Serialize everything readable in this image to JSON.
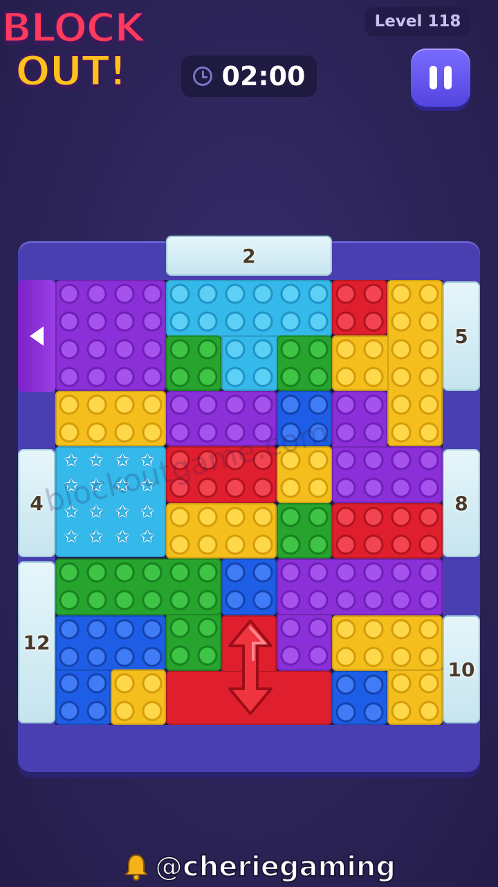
{
  "app": {
    "logo_line1": "BLOCK",
    "logo_line2": "OUT!"
  },
  "hud": {
    "level_label": "Level 118",
    "timer": "02:00",
    "pause_icon": "pause-icon",
    "clock_icon": "clock-icon"
  },
  "board": {
    "gates": {
      "top": "2",
      "right_upper": "5",
      "left_middle": "4",
      "right_middle": "8",
      "left_lower": "12",
      "right_lower": "10"
    },
    "left_exit_icon": "triangle-left-icon",
    "piece_colors": {
      "purple": "#8b2fd8",
      "lightblue": "#35b8ea",
      "red": "#e01f2e",
      "yellow": "#f4be1c",
      "green": "#26a42e",
      "blue": "#1e5ee6"
    }
  },
  "watermark": "blockoutgame.com",
  "footer": {
    "handle": "@cheriegaming",
    "icon": "bell-icon"
  }
}
